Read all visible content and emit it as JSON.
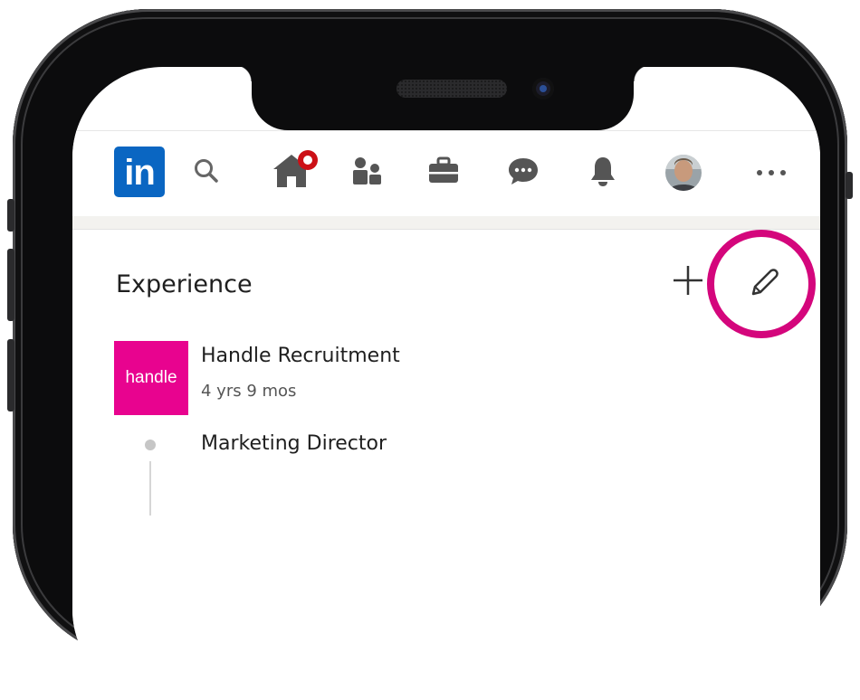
{
  "nav": {
    "logo_text": "in",
    "items": [
      {
        "name": "search-icon"
      },
      {
        "name": "home-icon",
        "notification": true
      },
      {
        "name": "my-network-icon"
      },
      {
        "name": "jobs-icon"
      },
      {
        "name": "messaging-icon"
      },
      {
        "name": "notifications-icon"
      },
      {
        "name": "profile-avatar"
      },
      {
        "name": "more-icon"
      }
    ]
  },
  "experience": {
    "title": "Experience",
    "company": {
      "logo_text": "handle",
      "name": "Handle Recruitment",
      "duration": "4 yrs 9 mos"
    },
    "role": "Marketing Director"
  },
  "colors": {
    "linkedin_blue": "#0a66c2",
    "highlight": "#d4067c",
    "company_brand": "#e8038f",
    "notification_red": "#cc1016"
  }
}
